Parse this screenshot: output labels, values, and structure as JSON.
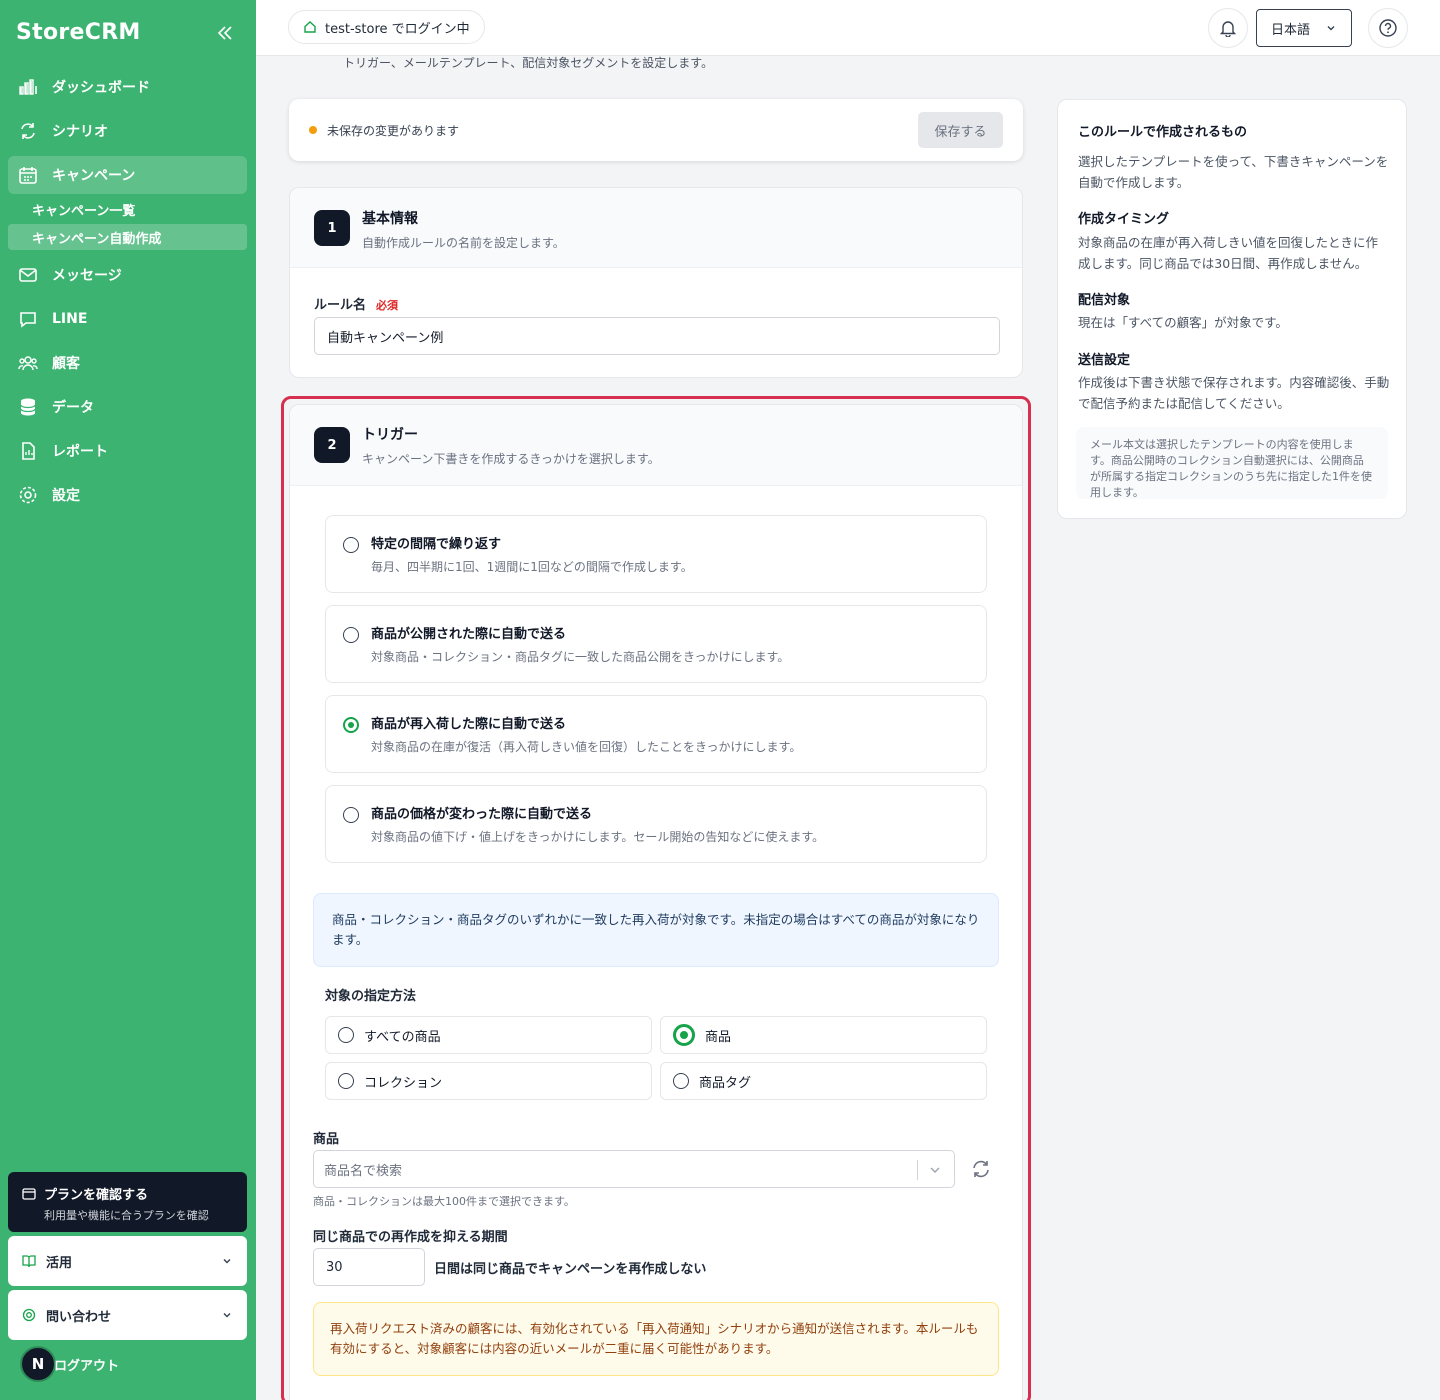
{
  "sidebar": {
    "brand": "StoreCRM",
    "items": [
      {
        "label": "ダッシュボード",
        "icon": "bar-chart-icon"
      },
      {
        "label": "シナリオ",
        "icon": "refresh-icon"
      },
      {
        "label": "キャンペーン",
        "icon": "calendar-icon"
      },
      {
        "label": "メッセージ",
        "icon": "mail-icon"
      },
      {
        "label": "LINE",
        "icon": "chat-icon"
      },
      {
        "label": "顧客",
        "icon": "users-icon"
      },
      {
        "label": "データ",
        "icon": "database-icon"
      },
      {
        "label": "レポート",
        "icon": "file-icon"
      },
      {
        "label": "設定",
        "icon": "gear-icon"
      }
    ],
    "subitems": [
      {
        "label": "キャンペーン一覧"
      },
      {
        "label": "キャンペーン自動作成"
      }
    ],
    "plan": {
      "title": "プランを確認する",
      "subtitle": "利用量や機能に合うプランを確認"
    },
    "usage_label": "活用",
    "contact_label": "問い合わせ",
    "logout_label": "ログアウト",
    "avatar_initial": "N"
  },
  "topbar": {
    "store_label": "test-store でログイン中",
    "language": "日本語"
  },
  "page": {
    "subtitle": "トリガー、メールテンプレート、配信対象セグメントを設定します。"
  },
  "savebar": {
    "message": "未保存の変更があります",
    "save_label": "保存する"
  },
  "basic": {
    "step": "1",
    "title": "基本情報",
    "subtitle": "自動作成ルールの名前を設定します。",
    "rule_name_label": "ルール名",
    "required_label": "必須",
    "rule_name_value": "自動キャンペーン例"
  },
  "trigger": {
    "step": "2",
    "title": "トリガー",
    "subtitle": "キャンペーン下書きを作成するきっかけを選択します。",
    "options": [
      {
        "title": "特定の間隔で繰り返す",
        "desc": "毎月、四半期に1回、1週間に1回などの間隔で作成します。",
        "selected": false
      },
      {
        "title": "商品が公開された際に自動で送る",
        "desc": "対象商品・コレクション・商品タグに一致した商品公開をきっかけにします。",
        "selected": false
      },
      {
        "title": "商品が再入荷した際に自動で送る",
        "desc": "対象商品の在庫が復活（再入荷しきい値を回復）したことをきっかけにします。",
        "selected": true
      },
      {
        "title": "商品の価格が変わった際に自動で送る",
        "desc": "対象商品の値下げ・値上げをきっかけにします。セール開始の告知などに使えます。",
        "selected": false
      }
    ],
    "info": "商品・コレクション・商品タグのいずれかに一致した再入荷が対象です。未指定の場合はすべての商品が対象になります。",
    "target_method_label": "対象の指定方法",
    "targets": [
      {
        "label": "すべての商品",
        "selected": false
      },
      {
        "label": "商品",
        "selected": true
      },
      {
        "label": "コレクション",
        "selected": false
      },
      {
        "label": "商品タグ",
        "selected": false
      }
    ],
    "product_label": "商品",
    "product_placeholder": "商品名で検索",
    "product_hint": "商品・コレクションは最大100件まで選択できます。",
    "suppress_label": "同じ商品での再作成を抑える期間",
    "suppress_days": "30",
    "suppress_suffix": "日間は同じ商品でキャンペーンを再作成しない",
    "warning": "再入荷リクエスト済みの顧客には、有効化されている「再入荷通知」シナリオから通知が送信されます。本ルールも有効にすると、対象顧客には内容の近いメールが二重に届く可能性があります。"
  },
  "right_panel": {
    "title": "このルールで作成されるもの",
    "intro": "選択したテンプレートを使って、下書きキャンペーンを自動で作成します。",
    "timing_title": "作成タイミング",
    "timing_text": "対象商品の在庫が再入荷しきい値を回復したときに作成します。同じ商品では30日間、再作成しません。",
    "audience_title": "配信対象",
    "audience_text": "現在は「すべての顧客」が対象です。",
    "send_title": "送信設定",
    "send_text": "作成後は下書き状態で保存されます。内容確認後、手動で配信予約または配信してください。",
    "note": "メール本文は選択したテンプレートの内容を使用します。商品公開時のコレクション自動選択には、公開商品が所属する指定コレクションのうち先に指定した1件を使用します。"
  },
  "colors": {
    "sidebar": "#3cb371",
    "accent": "#16a34a",
    "highlight": "#d62f4f"
  }
}
